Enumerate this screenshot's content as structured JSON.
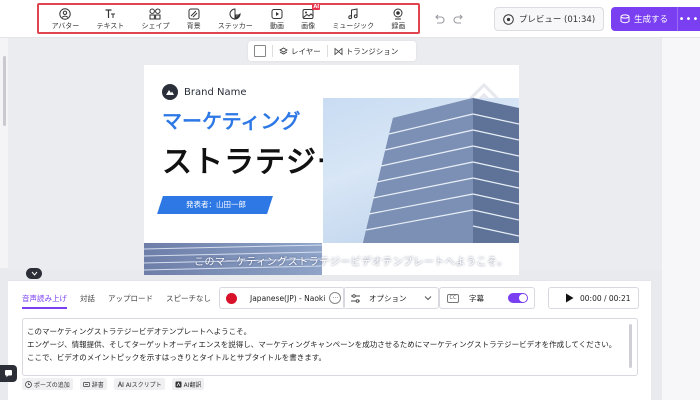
{
  "toolbar": {
    "tools": [
      {
        "label": "アバター",
        "icon": "avatar-icon"
      },
      {
        "label": "テキスト",
        "icon": "text-icon"
      },
      {
        "label": "シェイプ",
        "icon": "shape-icon"
      },
      {
        "label": "背景",
        "icon": "background-icon"
      },
      {
        "label": "ステッカー",
        "icon": "sticker-icon"
      },
      {
        "label": "動画",
        "icon": "video-icon"
      },
      {
        "label": "画像",
        "icon": "image-icon",
        "badge": "AI"
      },
      {
        "label": "ミュージック",
        "icon": "music-icon"
      },
      {
        "label": "録画",
        "icon": "record-icon"
      }
    ],
    "preview_label": "プレビュー (01:34)",
    "generate_label": "生成する",
    "more_label": "•••"
  },
  "layer_bar": {
    "layer_label": "レイヤー",
    "transition_label": "トランジション"
  },
  "slide": {
    "brand_name": "Brand Name",
    "title_line1": "マーケティング",
    "title_line2": "ストラテジー",
    "presenter": "発表者：山田一郎",
    "subtitle_overlay": "このマーケティングストラテジービデオテンプレートへようこそ。"
  },
  "panel": {
    "tabs": [
      "音声読み上げ",
      "対話",
      "アップロード",
      "スピーチなし"
    ],
    "active_tab": "音声読み上げ",
    "voice": "Japanese(JP) - Naoki",
    "voice_more": "···",
    "option_label": "オプション",
    "caption_label": "字幕",
    "caption_enabled": true,
    "time": "00:00 / 00:21",
    "script_lines": [
      "このマーケティングストラテジービデオテンプレートへようこそ。",
      "エンゲージ、情報提供、そしてターゲットオーディエンスを説得し、マーケティングキャンペーンを成功させるためにマーケティングストラテジービデオを作成してください。",
      "ここで、ビデオのメイントピックを示すはっきりとタイトルとサブタイトルを書きます。"
    ],
    "chips": [
      {
        "label": "ポーズの追加",
        "icon": "clock-icon"
      },
      {
        "label": "辞書",
        "icon": "dictionary-icon"
      },
      {
        "label": "AIスクリプト",
        "icon": "ai-script-icon"
      },
      {
        "label": "AI翻訳",
        "icon": "ai-translate-icon"
      }
    ]
  },
  "colors": {
    "accent": "#7b3ff2",
    "highlight_border": "#e0454f",
    "slide_blue": "#2e78e6",
    "flag_red": "#d9122b"
  }
}
